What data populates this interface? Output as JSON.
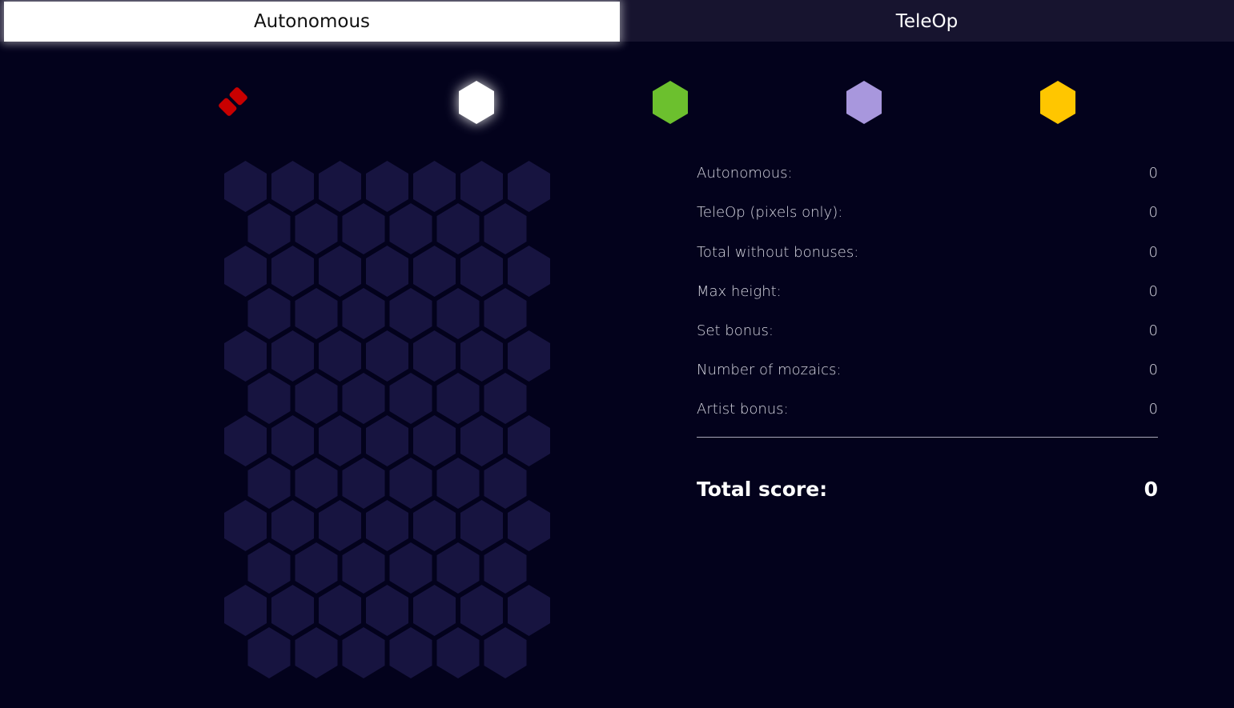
{
  "tabs": {
    "autonomous": "Autonomous",
    "teleop": "TeleOp"
  },
  "palette": [
    {
      "name": "eraser",
      "color": "#c80000",
      "selected": false
    },
    {
      "name": "white",
      "color": "#ffffff",
      "selected": true
    },
    {
      "name": "green",
      "color": "#6cc02e",
      "selected": false
    },
    {
      "name": "purple",
      "color": "#a897dd",
      "selected": false
    },
    {
      "name": "yellow",
      "color": "#ffc600",
      "selected": false
    }
  ],
  "board": {
    "rows": 12,
    "odd_row_cells": 7,
    "even_row_cells": 6,
    "empty_color": "#171440"
  },
  "scores": {
    "items": [
      {
        "label": "Autonomous:",
        "value": "0"
      },
      {
        "label": "TeleOp (pixels only):",
        "value": "0"
      },
      {
        "label": "Total without bonuses:",
        "value": "0"
      },
      {
        "label": "Max height:",
        "value": "0"
      },
      {
        "label": "Set bonus:",
        "value": "0"
      },
      {
        "label": "Number of mozaics:",
        "value": "0"
      },
      {
        "label": "Artist bonus:",
        "value": "0"
      }
    ],
    "total_label": "Total score:",
    "total_value": "0"
  }
}
